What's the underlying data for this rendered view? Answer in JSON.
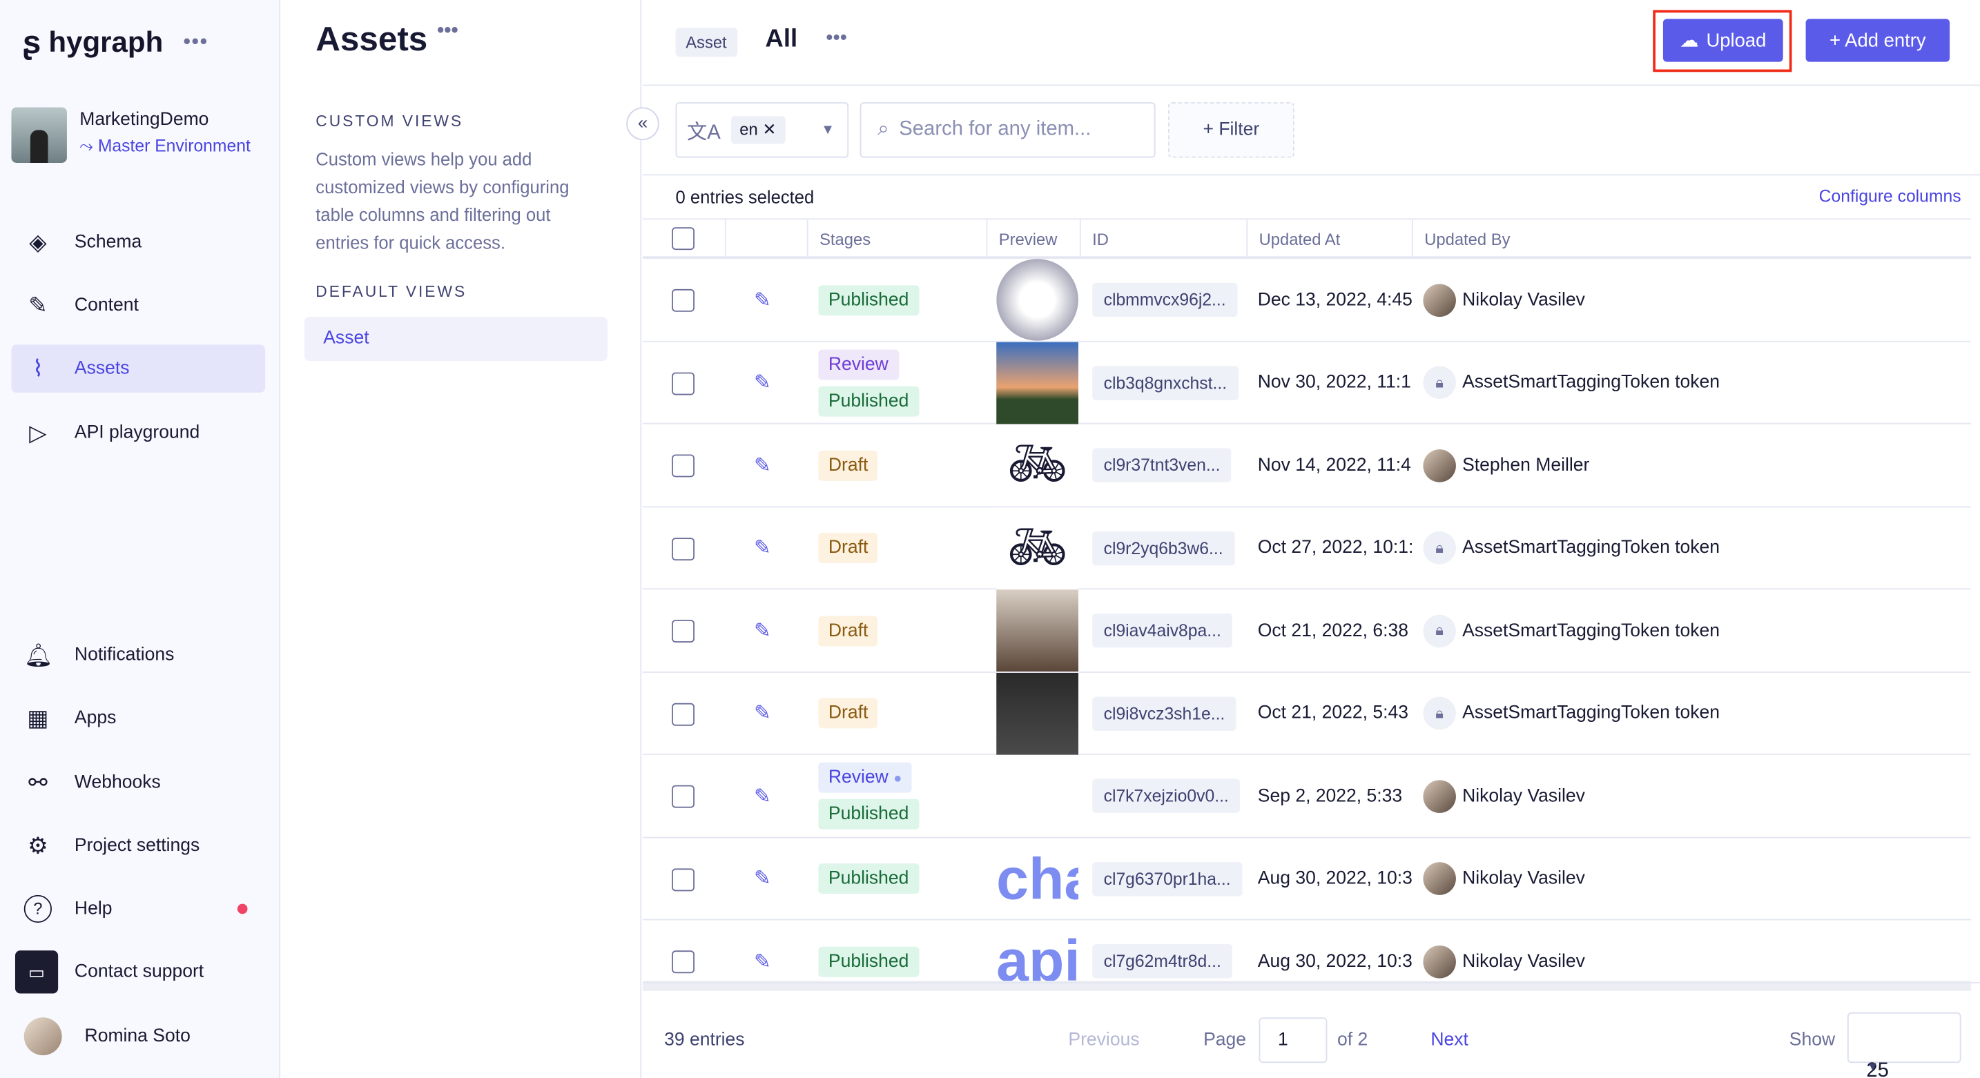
{
  "app": {
    "logo": "hygraph",
    "project_name": "MarketingDemo",
    "environment": "Master Environment"
  },
  "sidebar": {
    "items": [
      {
        "label": "Schema",
        "icon": "layers-icon"
      },
      {
        "label": "Content",
        "icon": "edit-icon"
      },
      {
        "label": "Assets",
        "icon": "paperclip-icon",
        "active": true
      },
      {
        "label": "API playground",
        "icon": "play-icon"
      },
      {
        "label": "Notifications",
        "icon": "bell-icon"
      },
      {
        "label": "Apps",
        "icon": "grid-icon"
      },
      {
        "label": "Webhooks",
        "icon": "webhook-icon"
      },
      {
        "label": "Project settings",
        "icon": "gear-icon"
      },
      {
        "label": "Help",
        "icon": "help-icon"
      },
      {
        "label": "Contact support",
        "icon": "chat-icon"
      },
      {
        "label": "Romina Soto",
        "icon": "avatar"
      }
    ]
  },
  "views": {
    "title": "Assets",
    "custom_heading": "CUSTOM VIEWS",
    "custom_desc": "Custom views help you add customized views by configuring table columns and filtering out entries for quick access.",
    "default_heading": "DEFAULT VIEWS",
    "default_item": "Asset"
  },
  "header": {
    "model_tag": "Asset",
    "view_name": "All",
    "upload": "Upload",
    "add_entry": "+ Add entry"
  },
  "filters": {
    "locale": "en",
    "search_placeholder": "Search for any item...",
    "filter": "+ Filter"
  },
  "table": {
    "selected": "0 entries selected",
    "configure": "Configure columns",
    "columns": [
      "Stages",
      "Preview",
      "ID",
      "Updated At",
      "Updated By"
    ],
    "rows": [
      {
        "stages": [
          "Published"
        ],
        "preview": "shuttle",
        "id": "clbmmvcx96j2...",
        "updated_at": "Dec 13, 2022, 4:45",
        "updated_by": "Nikolay Vasilev",
        "user_type": "person"
      },
      {
        "stages": [
          "Review",
          "Published"
        ],
        "preview": "sky",
        "id": "clb3q8gnxchst...",
        "updated_at": "Nov 30, 2022, 11:1",
        "updated_by": "AssetSmartTaggingToken token",
        "user_type": "token"
      },
      {
        "stages": [
          "Draft"
        ],
        "preview": "bike",
        "id": "cl9r37tnt3ven...",
        "updated_at": "Nov 14, 2022, 11:4",
        "updated_by": "Stephen Meiller",
        "user_type": "person"
      },
      {
        "stages": [
          "Draft"
        ],
        "preview": "bike",
        "id": "cl9r2yq6b3w6...",
        "updated_at": "Oct 27, 2022, 10:1:",
        "updated_by": "AssetSmartTaggingToken token",
        "user_type": "token"
      },
      {
        "stages": [
          "Draft"
        ],
        "preview": "dog",
        "id": "cl9iav4aiv8pa...",
        "updated_at": "Oct 21, 2022, 6:38",
        "updated_by": "AssetSmartTaggingToken token",
        "user_type": "token"
      },
      {
        "stages": [
          "Draft"
        ],
        "preview": "redbike",
        "id": "cl9i8vcz3sh1e...",
        "updated_at": "Oct 21, 2022, 5:43",
        "updated_by": "AssetSmartTaggingToken token",
        "user_type": "token"
      },
      {
        "stages": [
          "Review",
          "Published"
        ],
        "preview": "",
        "id": "cl7k7xejzio0v0...",
        "updated_at": "Sep 2, 2022, 5:33",
        "updated_by": "Nikolay Vasilev",
        "user_type": "person",
        "review_info": true
      },
      {
        "stages": [
          "Published"
        ],
        "preview": "cha",
        "id": "cl7g6370pr1ha...",
        "updated_at": "Aug 30, 2022, 10:3",
        "updated_by": "Nikolay Vasilev",
        "user_type": "person"
      },
      {
        "stages": [
          "Published"
        ],
        "preview": "api",
        "id": "cl7g62m4tr8d...",
        "updated_at": "Aug 30, 2022, 10:3",
        "updated_by": "Nikolay Vasilev",
        "user_type": "person"
      }
    ]
  },
  "footer": {
    "entries": "39 entries",
    "previous": "Previous",
    "page_label": "Page",
    "page": "1",
    "of": "of 2",
    "next": "Next",
    "show": "Show",
    "page_size": "25"
  },
  "colors": {
    "accent": "#5b5bea",
    "highlight": "#f02a16"
  }
}
